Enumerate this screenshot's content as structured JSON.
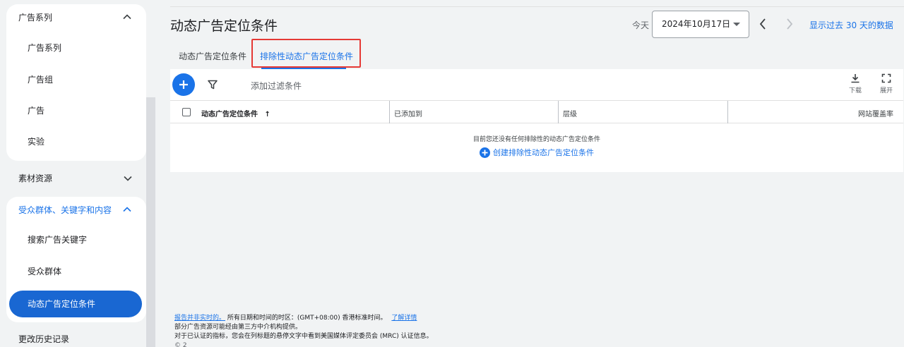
{
  "sidebar": {
    "campaigns_header": "广告系列",
    "campaigns_items": [
      "广告系列",
      "广告组",
      "广告",
      "实验"
    ],
    "assets": "素材资源",
    "audience_header": "受众群体、关键字和内容",
    "audience_items": [
      "搜索广告关键字",
      "受众群体"
    ],
    "active_item": "动态广告定位条件",
    "change_history": "更改历史记录"
  },
  "header": {
    "title": "动态广告定位条件",
    "today_label": "今天",
    "date_value": "2024年10月17日",
    "show_last_30": "显示过去 30 天的数据"
  },
  "tabs": [
    {
      "label": "动态广告定位条件"
    },
    {
      "label": "排除性动态广告定位条件"
    }
  ],
  "toolbar": {
    "add_filter": "添加过滤条件",
    "download": "下载",
    "expand": "展开"
  },
  "table": {
    "columns": [
      "动态广告定位条件",
      "已添加到",
      "层级",
      "网站覆盖率"
    ],
    "empty_message": "目前您还没有任何排除性的动态广告定位条件",
    "create_link": "创建排除性动态广告定位条件"
  },
  "footer": {
    "not_realtime_link": "报告并非实时的。",
    "timezone_text": "所有日期和时间的时区：(GMT+08:00) 香港标准时间。",
    "learn_more": "了解详情",
    "line2": "部分广告资源可能经由第三方中介机构提供。",
    "line3": "对于已认证的指标，您会在列标题的悬停文字中看到美国媒体评定委员会 (MRC) 认证信息。",
    "line4": "© 2"
  },
  "colors": {
    "accent": "#1a73e8",
    "active_nav": "#1967d2",
    "highlight": "#e53935"
  }
}
